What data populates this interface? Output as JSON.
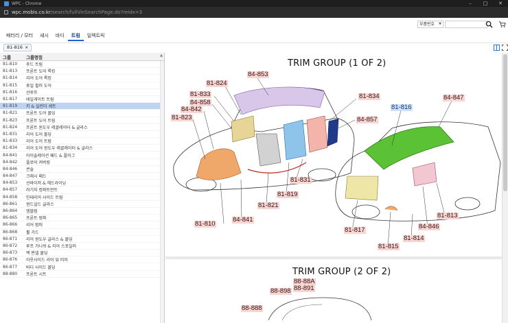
{
  "window": {
    "title": "WPC - Chrome",
    "controls": [
      "–",
      "□",
      "✕"
    ]
  },
  "url": {
    "host": "wpc.mobis.co.kr",
    "path": "/search/fullVinSearchPage.do?reidx=3"
  },
  "tabs": [
    "배터리 / 모터",
    "섀시",
    "바디",
    "트림",
    "일렉트릭"
  ],
  "active_tab_index": 3,
  "search": {
    "type_select": "부품번호",
    "value": "",
    "placeholder": ""
  },
  "filter_chip": {
    "label": "81-816",
    "close": "×"
  },
  "grid": {
    "headers": [
      "그룹",
      "그룹명칭"
    ],
    "selected_index": 6,
    "rows": [
      [
        "81-810",
        "후드 트림"
      ],
      [
        "81-813",
        "프론트 도어 록킹"
      ],
      [
        "81-814",
        "리어 도어 록킹"
      ],
      [
        "81-815",
        "휴일 필러 도어"
      ],
      [
        "81-816",
        "선루프"
      ],
      [
        "81-817",
        "테일게이트 트림"
      ],
      [
        "81-819",
        "키 & 실린더 세트"
      ],
      [
        "81-821",
        "프론트 도어 몰딩"
      ],
      [
        "81-823",
        "프론트 도어 트림"
      ],
      [
        "81-824",
        "프론트 윈도우 레귤레이터 & 글라스"
      ],
      [
        "81-831",
        "리어 도어 몰딩"
      ],
      [
        "81-833",
        "리어 도어 트림"
      ],
      [
        "81-834",
        "리어 도어 윈도우 레귤레이터 & 글라스"
      ],
      [
        "84-841",
        "아이솔레이션 패드 & 플러그"
      ],
      [
        "84-842",
        "플로어 커버링"
      ],
      [
        "84-846",
        "콘솔"
      ],
      [
        "84-847",
        "크래시 패드"
      ],
      [
        "84-853",
        "선바이저 & 헤드라이닝"
      ],
      [
        "84-857",
        "러기지 컴파트먼트"
      ],
      [
        "84-858",
        "인테리어 사이드 트림"
      ],
      [
        "86-861",
        "윈드실드 글라스"
      ],
      [
        "86-864",
        "엠블럼"
      ],
      [
        "86-865",
        "프론트 범퍼"
      ],
      [
        "86-866",
        "리어 범퍼"
      ],
      [
        "86-868",
        "휠 가드"
      ],
      [
        "86-871",
        "리어 윈도우 글라스 & 몰딩"
      ],
      [
        "86-872",
        "루프 가니쉬 & 리어 스포일러"
      ],
      [
        "86-873",
        "백 판넬 몰딩"
      ],
      [
        "86-876",
        "아웃사이드 리어 뷰 미러"
      ],
      [
        "86-877",
        "바디 사이드 몰딩"
      ],
      [
        "88-880",
        "프론트 시트"
      ]
    ]
  },
  "diagram1": {
    "title": "TRIM GROUP (1 OF 2)",
    "selected_label": "81-816",
    "labels": [
      "84-853",
      "81-824",
      "81-833",
      "84-858",
      "84-842",
      "81-823",
      "81-834",
      "84-857",
      "81-816",
      "84-847",
      "81-831",
      "81-819",
      "81-821",
      "81-810",
      "84-841",
      "81-813",
      "84-846",
      "81-817",
      "81-815",
      "81-814"
    ]
  },
  "diagram2": {
    "title": "TRIM GROUP (2 OF 2)",
    "labels": [
      "88-88A",
      "88-891",
      "88-898",
      "88-888"
    ]
  },
  "colors": {
    "accent": "#1a63c9",
    "label_bg": "#f6d6d2",
    "selected_row": "#bed3f1",
    "sunroof": "#5bc236"
  }
}
